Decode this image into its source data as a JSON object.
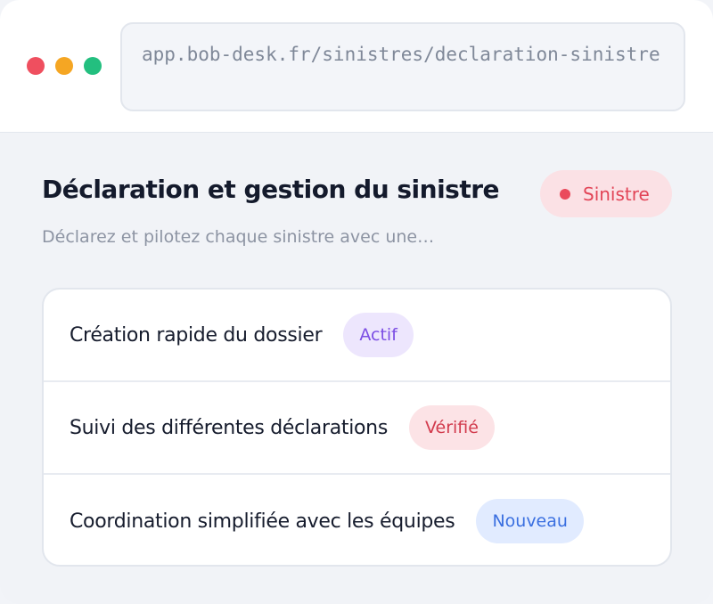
{
  "window": {
    "url": "app.bob-desk.fr/sinistres/declaration-sinistre"
  },
  "header": {
    "title": "Déclaration et gestion du sinistre",
    "badge": "Sinistre",
    "subtitle": "Déclarez et pilotez chaque sinistre avec une…"
  },
  "features": [
    {
      "label": "Création rapide du dossier",
      "status": "Actif"
    },
    {
      "label": "Suivi des différentes déclarations",
      "status": "Vérifié"
    },
    {
      "label": "Coordination simplifiée avec les équipes",
      "status": "Nouveau"
    }
  ],
  "colors": {
    "window_dot_red": "#ef4f5f",
    "window_dot_yellow": "#f5a623",
    "window_dot_green": "#23bf7f",
    "badge_sinistre": "#e24557",
    "status_actif": "#7c4ee4",
    "status_verifie": "#d23b4d",
    "status_nouveau": "#3a6fe0"
  }
}
